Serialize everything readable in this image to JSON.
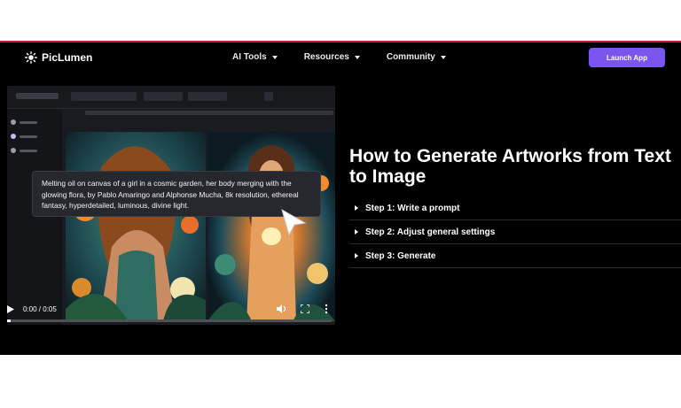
{
  "brand": {
    "name": "PicLumen"
  },
  "nav": {
    "items": [
      {
        "label": "AI Tools"
      },
      {
        "label": "Resources"
      },
      {
        "label": "Community"
      }
    ],
    "launch_label": "Launch App"
  },
  "video": {
    "prompt_tooltip": "Melting oil on canvas of a girl in a cosmic garden, her body merging with the glowing flora, by Pablo Amaringo and Alphonse Mucha, 8k resolution, ethereal fantasy, hyperdetailed, luminous, divine light.",
    "time": "0:00 / 0:05",
    "progress": 0.01
  },
  "tutorial": {
    "title": "How to Generate Artworks from Text to Image",
    "steps": [
      {
        "label": "Step 1: Write a prompt"
      },
      {
        "label": "Step 2: Adjust general settings"
      },
      {
        "label": "Step 3: Generate"
      }
    ]
  },
  "colors": {
    "accent": "#7b55f0",
    "top_border": "#c41c3a",
    "background": "#000000"
  }
}
